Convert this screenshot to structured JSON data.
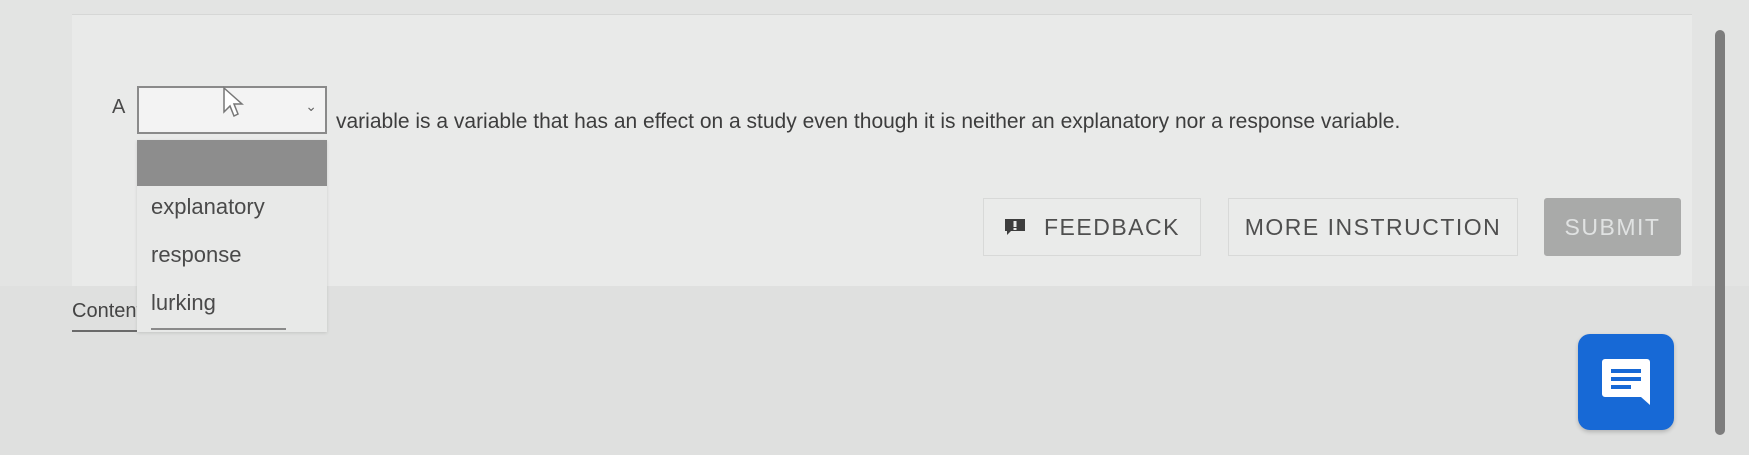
{
  "question": {
    "prefix": "A",
    "suffix": "variable is a variable that has an effect on a study even though it is neither an explanatory nor a response variable.",
    "select_value": ""
  },
  "dropdown": {
    "options": [
      "explanatory",
      "response",
      "lurking"
    ]
  },
  "actions": {
    "feedback_label": "FEEDBACK",
    "more_instruction_label": "MORE INSTRUCTION",
    "submit_label": "SUBMIT"
  },
  "tabs": {
    "content_label": "Content"
  },
  "icons": {
    "feedback": "comment-icon",
    "chat": "chat-icon",
    "caret": "chevron-down-icon",
    "cursor": "mouse-pointer-icon"
  },
  "colors": {
    "chat_button": "#1769d6",
    "submit_disabled": "#a9aaa9",
    "dropdown_highlight": "#8d8d8d"
  }
}
